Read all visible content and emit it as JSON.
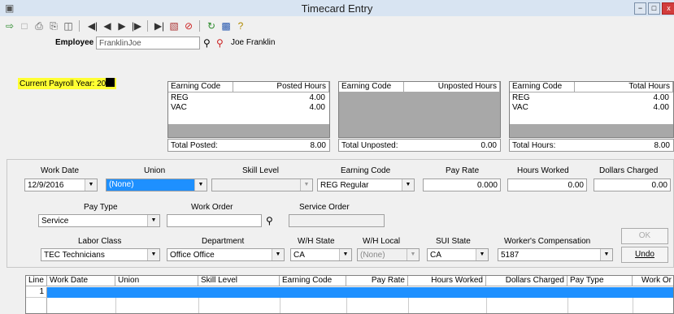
{
  "window": {
    "title": "Timecard Entry",
    "close_glyph": "x",
    "min_glyph": "−",
    "max_glyph": "□"
  },
  "toolbar": [
    "exit-icon",
    "save-icon",
    "print-icon",
    "printer-icon",
    "preview-icon",
    "first-record-icon",
    "prev-record-icon",
    "next-record-icon",
    "last-record-icon",
    "insert-record-icon",
    "delete-record-icon",
    "cancel-icon",
    "refresh-icon",
    "lookup-icon",
    "help-icon"
  ],
  "employee": {
    "label": "Employee",
    "value": "FranklinJoe",
    "name": "Joe Franklin"
  },
  "payroll_year": {
    "label": "Current Payroll Year:",
    "value": "20",
    "highlight": "#ffff33"
  },
  "posted": {
    "h_code": "Earning Code",
    "h_hours": "Posted Hours",
    "rows": [
      {
        "code": "REG",
        "hours": "4.00"
      },
      {
        "code": "VAC",
        "hours": "4.00"
      }
    ],
    "total_label": "Total Posted:",
    "total_value": "8.00"
  },
  "unposted": {
    "h_code": "Earning Code",
    "h_hours": "Unposted Hours",
    "total_label": "Total Unposted:",
    "total_value": "0.00"
  },
  "total": {
    "h_code": "Earning Code",
    "h_hours": "Total Hours",
    "rows": [
      {
        "code": "REG",
        "hours": "4.00"
      },
      {
        "code": "VAC",
        "hours": "4.00"
      }
    ],
    "total_label": "Total Hours:",
    "total_value": "8.00"
  },
  "form": {
    "work_date": {
      "label": "Work Date",
      "value": "12/9/2016"
    },
    "union": {
      "label": "Union",
      "value": "(None)"
    },
    "skill_level": {
      "label": "Skill Level",
      "value": ""
    },
    "earning_code": {
      "label": "Earning Code",
      "value": "REG  Regular"
    },
    "pay_rate": {
      "label": "Pay Rate",
      "value": "0.000"
    },
    "hours_worked": {
      "label": "Hours Worked",
      "value": "0.00"
    },
    "dollars_charged": {
      "label": "Dollars Charged",
      "value": "0.00"
    },
    "pay_type": {
      "label": "Pay Type",
      "value": "Service"
    },
    "work_order": {
      "label": "Work Order",
      "value": ""
    },
    "service_order": {
      "label": "Service Order",
      "value": ""
    },
    "labor_class": {
      "label": "Labor Class",
      "value": "TEC  Technicians"
    },
    "department": {
      "label": "Department",
      "value": "Office  Office"
    },
    "wh_state": {
      "label": "W/H State",
      "value": "CA"
    },
    "wh_local": {
      "label": "W/H Local",
      "value": "(None)"
    },
    "sui_state": {
      "label": "SUI State",
      "value": "CA"
    },
    "workers_comp": {
      "label": "Worker's Compensation",
      "value": "5187"
    },
    "ok_button": "OK",
    "undo_button": "Undo"
  },
  "lines_grid": {
    "columns": [
      "Line",
      "Work Date",
      "Union",
      "Skill Level",
      "Earning Code",
      "Pay Rate",
      "Hours Worked",
      "Dollars Charged",
      "Pay Type",
      "Work Or"
    ],
    "rows": [
      {
        "line": "1"
      }
    ]
  },
  "colors": {
    "accent": "#1e90ff",
    "highlight": "#ffff33",
    "titlebar": "#d8e4f2",
    "close": "#d23c3c"
  }
}
